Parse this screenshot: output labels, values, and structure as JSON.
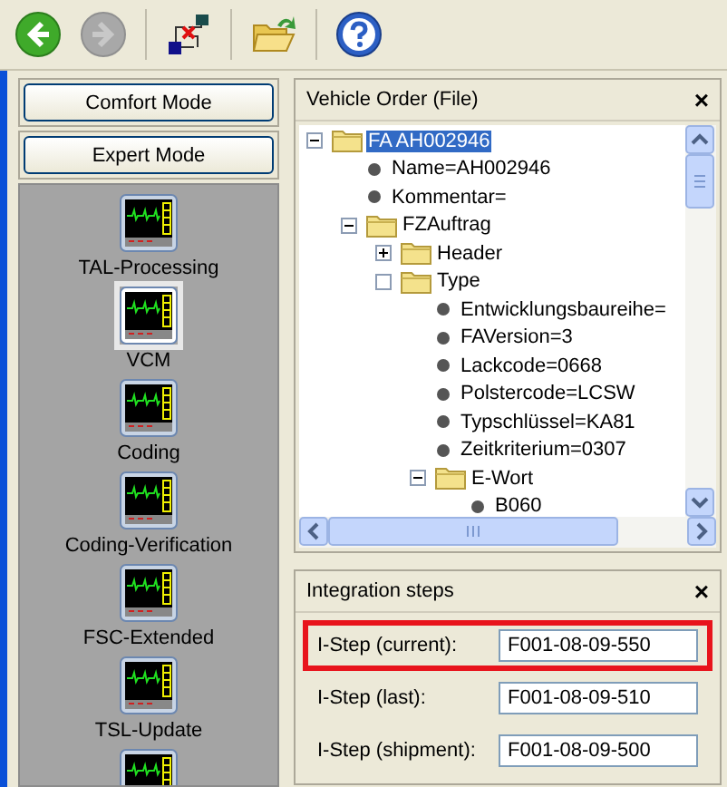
{
  "toolbar": {
    "buttons": [
      {
        "kind": "back",
        "disabled": false
      },
      {
        "kind": "forward",
        "disabled": true
      },
      {
        "kind": "network"
      },
      {
        "kind": "folder"
      },
      {
        "kind": "help"
      }
    ]
  },
  "mode_buttons": [
    "Comfort Mode",
    "Expert Mode"
  ],
  "modules": [
    {
      "label": "TAL-Processing",
      "selected": false
    },
    {
      "label": "VCM",
      "selected": true
    },
    {
      "label": "Coding",
      "selected": false
    },
    {
      "label": "Coding-Verification",
      "selected": false
    },
    {
      "label": "FSC-Extended",
      "selected": false
    },
    {
      "label": "TSL-Update",
      "selected": false
    },
    {
      "selected": false
    }
  ],
  "vehicle_order": {
    "title": "Vehicle Order (File)",
    "close": "×",
    "tree": [
      {
        "label": "FA AH002946",
        "kind": "folder",
        "expanded": true,
        "selected": true,
        "children": [
          {
            "label": "Name=AH002946",
            "kind": "leaf",
            "selected": false
          },
          {
            "label": "Kommentar=",
            "kind": "leaf",
            "selected": false
          },
          {
            "label": "FZAuftrag",
            "kind": "folder",
            "expanded": true,
            "selected": false,
            "children": [
              {
                "label": "Header",
                "kind": "folder",
                "expanded": false,
                "selected": false
              },
              {
                "label": "Type",
                "kind": "folder",
                "sign_hidden": true,
                "selected": false,
                "children": [
                  {
                    "label": "Entwicklungsbaureihe=",
                    "kind": "leaf",
                    "selected": false
                  },
                  {
                    "label": "FAVersion=3",
                    "kind": "leaf",
                    "selected": false
                  },
                  {
                    "label": "Lackcode=0668",
                    "kind": "leaf",
                    "selected": false
                  },
                  {
                    "label": "Polstercode=LCSW",
                    "kind": "leaf",
                    "selected": false
                  },
                  {
                    "label": "Typschlüssel=KA81",
                    "kind": "leaf",
                    "selected": false
                  },
                  {
                    "label": "Zeitkriterium=0307",
                    "kind": "leaf",
                    "selected": false
                  },
                  {
                    "label": "E-Wort",
                    "kind": "folder",
                    "expanded": true,
                    "selected": false,
                    "children": [
                      {
                        "label": "B060",
                        "kind": "leaf",
                        "selected": false
                      }
                    ]
                  }
                ]
              }
            ]
          }
        ]
      }
    ]
  },
  "integration_steps": {
    "title": "Integration steps",
    "close": "×",
    "rows": [
      {
        "label": "I-Step (current):",
        "value": "F001-08-09-550",
        "highlighted": true
      },
      {
        "label": "I-Step (last):",
        "value": "F001-08-09-510",
        "highlighted": false
      },
      {
        "label": "I-Step (shipment):",
        "value": "F001-08-09-500",
        "highlighted": false
      }
    ]
  }
}
